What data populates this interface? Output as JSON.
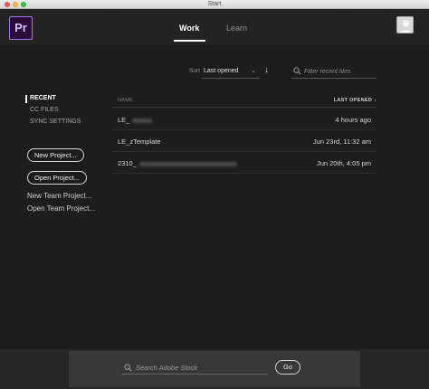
{
  "window": {
    "title": "Start"
  },
  "header": {
    "logo_text": "Pr",
    "tabs": [
      {
        "label": "Work",
        "active": true
      },
      {
        "label": "Learn",
        "active": false
      }
    ],
    "avatar_icon": "user-avatar-icon"
  },
  "toolbar": {
    "sort_label": "Sort",
    "sort_value": "Last opened",
    "sort_direction_icon": "arrow-down-icon",
    "filter_placeholder": "Filter recent files"
  },
  "sidebar": {
    "sections": [
      {
        "label": "RECENT",
        "active": true
      },
      {
        "label": "CC FILES",
        "active": false
      },
      {
        "label": "SYNC SETTINGS",
        "active": false
      }
    ],
    "buttons": [
      {
        "label": "New Project..."
      },
      {
        "label": "Open Project..."
      }
    ],
    "links": [
      {
        "label": "New Team Project..."
      },
      {
        "label": "Open Team Project..."
      }
    ]
  },
  "files": {
    "columns": {
      "name": "NAME",
      "last_opened": "LAST OPENED ↓"
    },
    "rows": [
      {
        "name": "LE_",
        "last_opened": "4 hours ago"
      },
      {
        "name": "LE_zTemplate",
        "last_opened": "Jun 23rd, 11:32 am"
      },
      {
        "name": "2310_",
        "last_opened": "Jun 20th, 4:05 pm"
      }
    ]
  },
  "stock": {
    "placeholder": "Search Adobe Stock",
    "go_label": "Go"
  },
  "colors": {
    "background": "#1d1d1d",
    "header": "#232323",
    "premiere_purple": "#9b7ae0",
    "stock_panel": "#383838"
  }
}
